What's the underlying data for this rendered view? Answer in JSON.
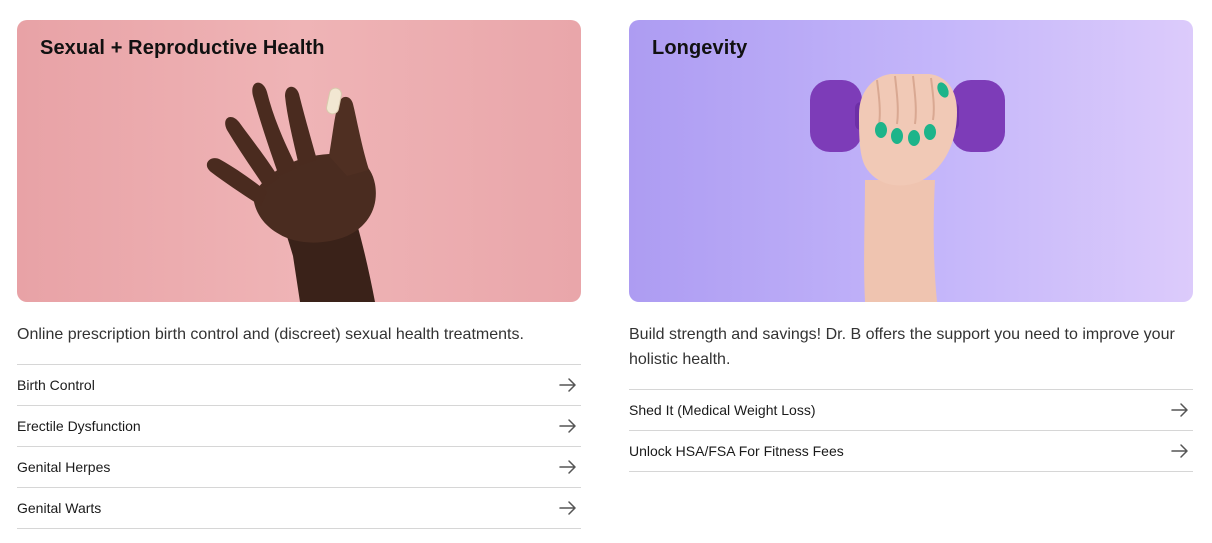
{
  "cards": [
    {
      "title": "Sexual + Reproductive Health",
      "description": "Online prescription birth control and (discreet) sexual health treatments.",
      "image_icon": "hand-holding-pill-image",
      "accent": "#eaa9ac",
      "links": [
        {
          "label": "Birth Control",
          "icon": "arrow-right-icon"
        },
        {
          "label": "Erectile Dysfunction",
          "icon": "arrow-right-icon"
        },
        {
          "label": "Genital Herpes",
          "icon": "arrow-right-icon"
        },
        {
          "label": "Genital Warts",
          "icon": "arrow-right-icon"
        }
      ]
    },
    {
      "title": "Longevity",
      "description": "Build strength and savings! Dr. B offers the support you need to improve your holistic health.",
      "image_icon": "hand-holding-dumbbell-image",
      "accent": "#bfb0f8",
      "links": [
        {
          "label": "Shed It (Medical Weight Loss)",
          "icon": "arrow-right-icon"
        },
        {
          "label": "Unlock HSA/FSA For Fitness Fees",
          "icon": "arrow-right-icon"
        }
      ]
    }
  ]
}
